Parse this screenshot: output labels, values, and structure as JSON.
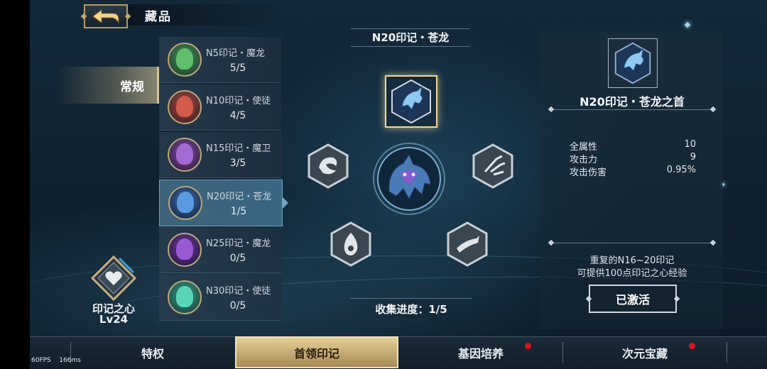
{
  "header": {
    "title": "藏品"
  },
  "category": {
    "label": "常规"
  },
  "heart": {
    "title": "印记之心",
    "level": "Lv24"
  },
  "marks": [
    {
      "name": "N5印记・魔龙",
      "progress": "5/5",
      "color": "#3f9a52",
      "active": false
    },
    {
      "name": "N10印记・使徒",
      "progress": "4/5",
      "color": "#c8423a",
      "active": false
    },
    {
      "name": "N15印记・魔卫",
      "progress": "3/5",
      "color": "#8a4fb8",
      "active": false
    },
    {
      "name": "N20印记・苍龙",
      "progress": "1/5",
      "color": "#3c7fc8",
      "active": true
    },
    {
      "name": "N25印记・魔龙",
      "progress": "0/5",
      "color": "#7a3db8",
      "active": false
    },
    {
      "name": "N30印记・使徒",
      "progress": "0/5",
      "color": "#2fa88f",
      "active": false
    }
  ],
  "center": {
    "title": "N20印记・苍龙",
    "collect": "收集进度：1/5"
  },
  "detail": {
    "title": "N20印记・苍龙之首",
    "stats": [
      {
        "label": "全属性",
        "value": "10"
      },
      {
        "label": "攻击力",
        "value": "9"
      },
      {
        "label": "攻击伤害",
        "value": "0.95%"
      }
    ],
    "desc_line1": "重复的N16~20印记",
    "desc_line2": "可提供100点印记之心经验",
    "button": "已激活"
  },
  "nav": [
    {
      "label": "特权",
      "active": false,
      "dot": false
    },
    {
      "label": "首领印记",
      "active": true,
      "dot": false
    },
    {
      "label": "基因培养",
      "active": false,
      "dot": true
    },
    {
      "label": "次元宝藏",
      "active": false,
      "dot": true
    }
  ],
  "debug": {
    "fps": "60FPS",
    "ms": "166ms"
  },
  "colors": {
    "accent": "#d8c28e",
    "dot": "#d8141a"
  }
}
